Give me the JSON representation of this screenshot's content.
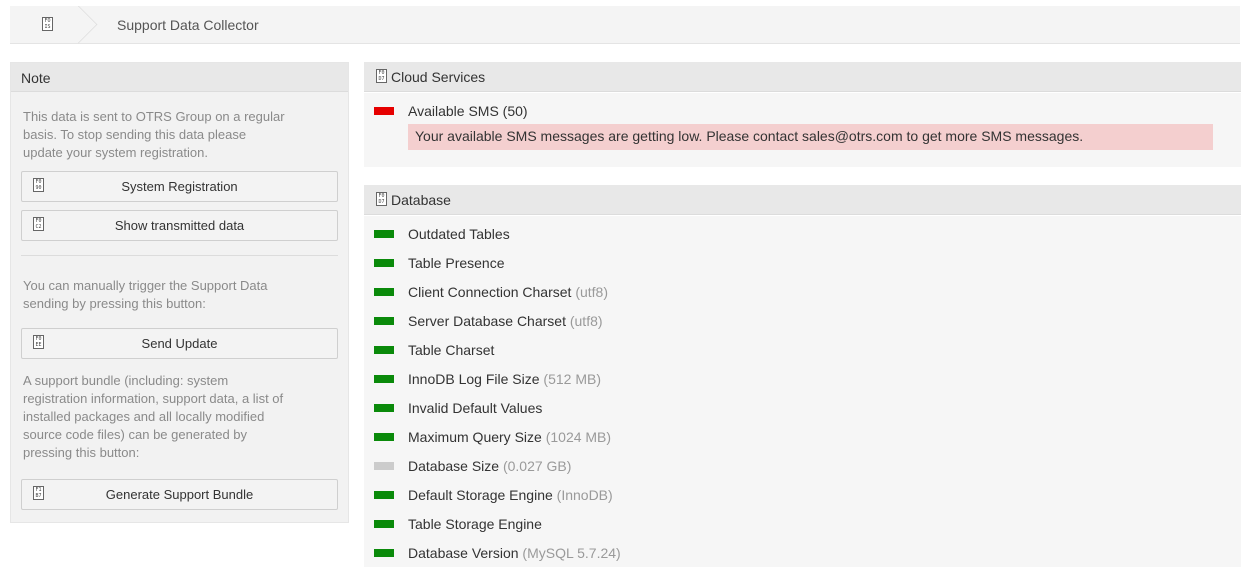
{
  "breadcrumb": {
    "icon": "FOIS",
    "label": "Support Data Collector"
  },
  "sidebar": {
    "title": "Note",
    "text1": "This data is sent to OTRS Group on a regular basis. To stop sending this data please update your system registration.",
    "text1_lines": [
      "This data is sent to OTRS Group on a regular",
      "basis. To stop sending this data please",
      "update your system registration."
    ],
    "btn_registration": {
      "label": "System Registration",
      "icon": "F090"
    },
    "btn_transmitted": {
      "label": "Show transmitted data",
      "icon": "F0C2"
    },
    "text2_lines": [
      "You can manually trigger the Support Data",
      "sending by pressing this button:"
    ],
    "btn_send": {
      "label": "Send Update",
      "icon": "F0EE"
    },
    "text3_lines": [
      "A support bundle (including: system",
      "registration information, support data, a list of",
      "installed packages and all locally modified",
      "source code files) can be generated by",
      "pressing this button:"
    ],
    "btn_bundle": {
      "label": "Generate Support Bundle",
      "icon": "F1B7"
    }
  },
  "cloud": {
    "title": "Cloud Services",
    "icon": "F0D7",
    "item": {
      "name": "Available SMS (50)",
      "status_color": "#e60000"
    },
    "message": "Your available SMS messages are getting low. Please contact sales@otrs.com to get more SMS messages."
  },
  "database": {
    "title": "Database",
    "icon": "F0D7",
    "items": [
      {
        "name": "Outdated Tables",
        "value": "",
        "status_color": "#0a8a0a"
      },
      {
        "name": "Table Presence",
        "value": "",
        "status_color": "#0a8a0a"
      },
      {
        "name": "Client Connection Charset",
        "value": "(utf8)",
        "status_color": "#0a8a0a"
      },
      {
        "name": "Server Database Charset",
        "value": "(utf8)",
        "status_color": "#0a8a0a"
      },
      {
        "name": "Table Charset",
        "value": "",
        "status_color": "#0a8a0a"
      },
      {
        "name": "InnoDB Log File Size",
        "value": "(512 MB)",
        "status_color": "#0a8a0a"
      },
      {
        "name": "Invalid Default Values",
        "value": "",
        "status_color": "#0a8a0a"
      },
      {
        "name": "Maximum Query Size",
        "value": "(1024 MB)",
        "status_color": "#0a8a0a"
      },
      {
        "name": "Database Size",
        "value": "(0.027 GB)",
        "status_color": "#cccccc"
      },
      {
        "name": "Default Storage Engine",
        "value": "(InnoDB)",
        "status_color": "#0a8a0a"
      },
      {
        "name": "Table Storage Engine",
        "value": "",
        "status_color": "#0a8a0a"
      },
      {
        "name": "Database Version",
        "value": "(MySQL 5.7.24)",
        "status_color": "#0a8a0a"
      }
    ]
  }
}
